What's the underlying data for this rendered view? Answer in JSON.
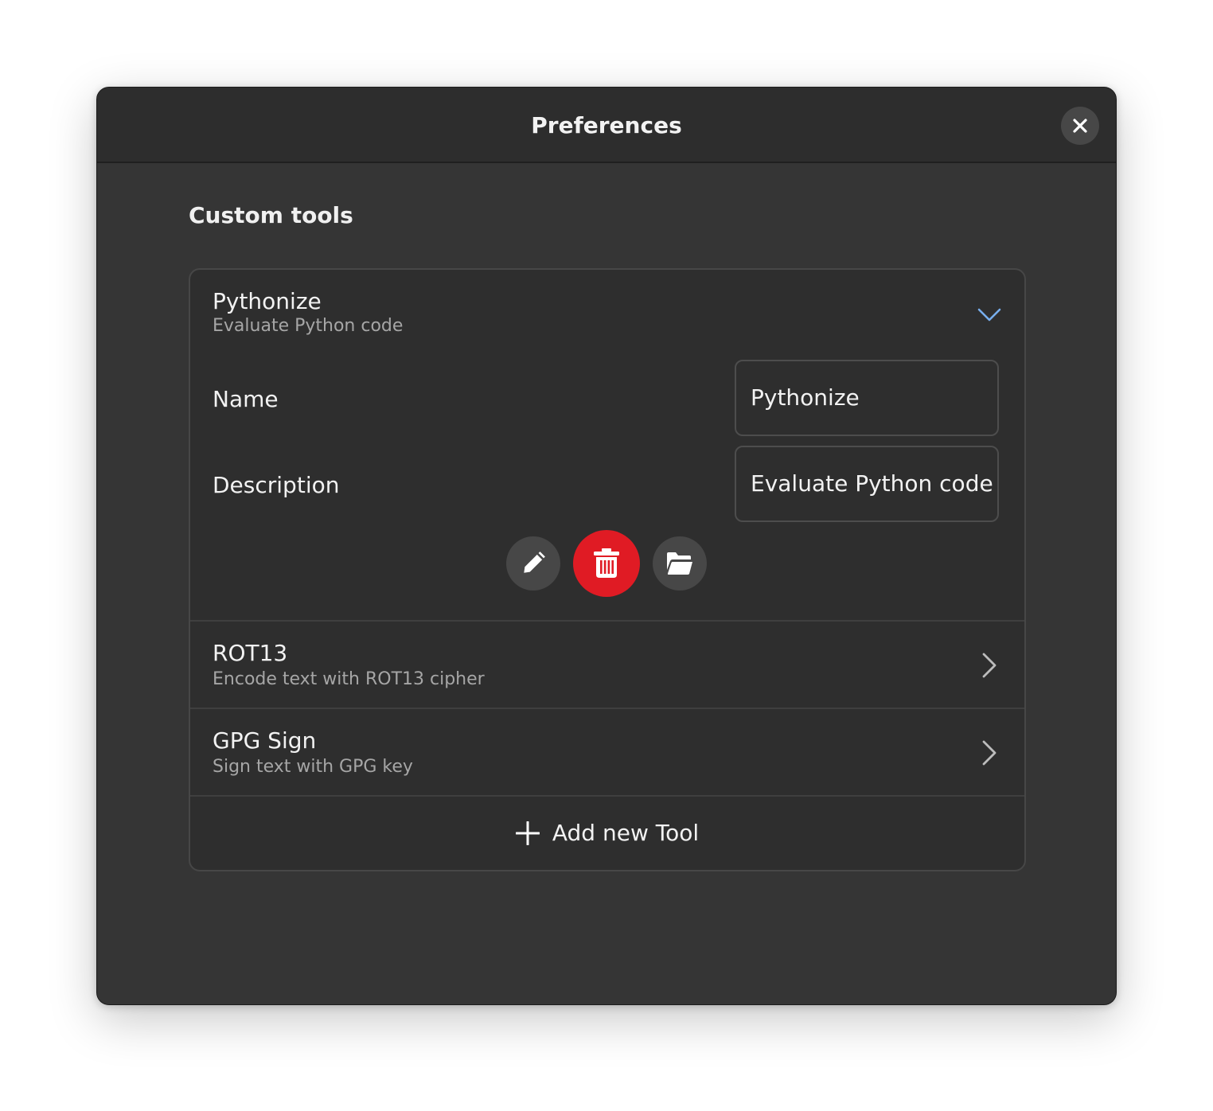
{
  "window": {
    "title": "Preferences"
  },
  "section": {
    "title": "Custom tools"
  },
  "tools": [
    {
      "title": "Pythonize",
      "subtitle": "Evaluate Python code",
      "expanded": true,
      "fields": {
        "name_label": "Name",
        "name_value": "Pythonize",
        "description_label": "Description",
        "description_value": "Evaluate Python code"
      }
    },
    {
      "title": "ROT13",
      "subtitle": "Encode text with ROT13 cipher",
      "expanded": false
    },
    {
      "title": "GPG Sign",
      "subtitle": "Sign text with GPG key",
      "expanded": false
    }
  ],
  "add_button": {
    "label": "Add new Tool"
  },
  "icons": {
    "close": "close-icon",
    "expand": "chevron-down-icon",
    "row": "chevron-right-icon",
    "edit": "pencil-icon",
    "delete": "trash-icon",
    "open": "folder-open-icon",
    "add": "plus-icon"
  },
  "colors": {
    "window_bg": "#353535",
    "headerbar_bg": "#2d2d2d",
    "list_bg": "#2e2e2e",
    "accent": "#78aeed",
    "destructive": "#e01b24"
  }
}
